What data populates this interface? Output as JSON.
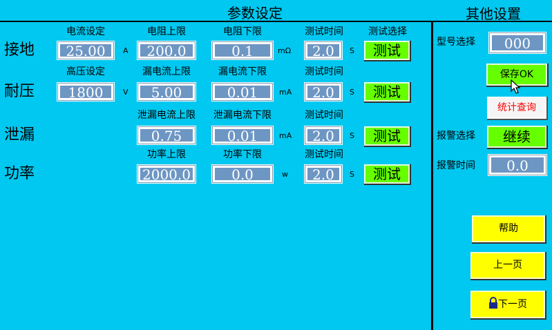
{
  "header": {
    "main_title": "参数设定",
    "side_title": "其他设置"
  },
  "ground": {
    "row_label": "接地",
    "current_set_label": "电流设定",
    "current_set_value": "25.00",
    "current_unit": "A",
    "res_upper_label": "电阻上限",
    "res_upper_value": "200.0",
    "res_lower_label": "电阻下限",
    "res_lower_value": "0.1",
    "res_unit": "mΩ",
    "test_time_label": "测试时间",
    "test_time_value": "2.0",
    "time_unit": "S",
    "test_select_label": "测试选择",
    "test_button": "测试"
  },
  "withstand": {
    "row_label": "耐压",
    "hv_set_label": "高压设定",
    "hv_set_value": "1800",
    "hv_unit": "V",
    "leak_upper_label": "漏电流上限",
    "leak_upper_value": "5.00",
    "leak_lower_label": "漏电流下限",
    "leak_lower_value": "0.01",
    "leak_unit": "mA",
    "test_time_label": "测试时间",
    "test_time_value": "2.0",
    "time_unit": "S",
    "test_button": "测试"
  },
  "leakage": {
    "row_label": "泄漏",
    "upper_label": "泄漏电流上限",
    "upper_value": "0.75",
    "lower_label": "泄漏电流下限",
    "lower_value": "0.01",
    "unit": "mA",
    "test_time_label": "测试时间",
    "test_time_value": "2.0",
    "time_unit": "S",
    "test_button": "测试"
  },
  "power": {
    "row_label": "功率",
    "upper_label": "功率上限",
    "upper_value": "2000.0",
    "lower_label": "功率下限",
    "lower_value": "0.0",
    "unit": "w",
    "test_time_label": "测试时间",
    "test_time_value": "2.0",
    "time_unit": "S",
    "test_button": "测试"
  },
  "side": {
    "model_label": "型号选择",
    "model_value": "000",
    "save_button": "保存OK",
    "stats_button": "统计查询",
    "alarm_select_label": "报警选择",
    "alarm_select_button": "继续",
    "alarm_time_label": "报警时间",
    "alarm_time_value": "0.0",
    "help_button": "帮助",
    "prev_button": "上一页",
    "next_button": "下一页"
  },
  "icons": {
    "cursor": "mouse-pointer-icon",
    "lock": "padlock-icon"
  },
  "colors": {
    "background": "#00c8f0",
    "field": "#6e96c3",
    "green_button": "#66ff00",
    "yellow_button": "#ffff00",
    "stats_text": "#ff0000"
  }
}
